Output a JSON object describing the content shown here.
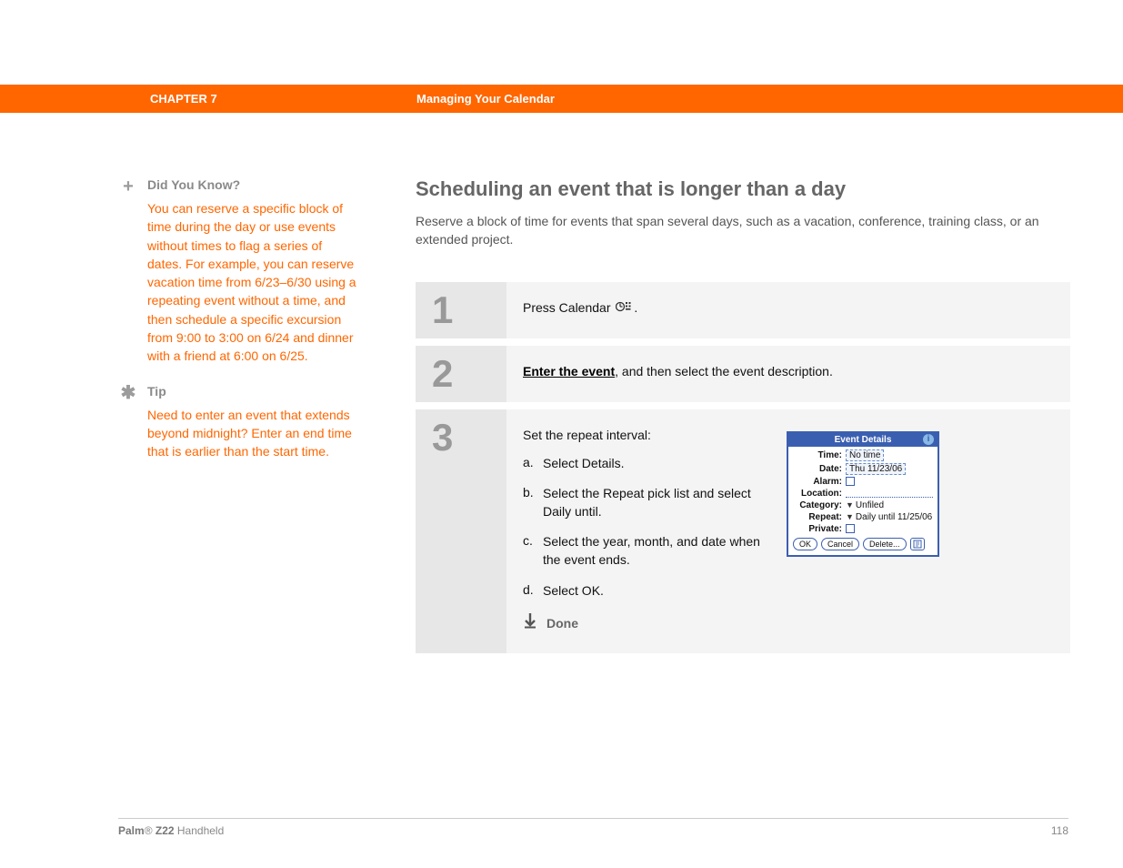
{
  "header": {
    "chapter": "CHAPTER 7",
    "title": "Managing Your Calendar"
  },
  "sidebar": {
    "dyk": {
      "label": "Did You Know?",
      "body": "You can reserve a specific block of time during the day or use events without times to flag a series of dates. For example, you can reserve vacation time from 6/23–6/30 using a repeating event without a time, and then schedule a specific excursion from 9:00 to 3:00 on 6/24 and dinner with a friend at 6:00 on 6/25."
    },
    "tip": {
      "label": "Tip",
      "body": "Need to enter an event that extends beyond midnight? Enter an end time that is earlier than the start time."
    }
  },
  "main": {
    "heading": "Scheduling an event that is longer than a day",
    "intro": "Reserve a block of time for events that span several days, such as a vacation, conference, training class, or an extended project.",
    "steps": {
      "s1": {
        "num": "1",
        "pre": "Press Calendar ",
        "post": "."
      },
      "s2": {
        "num": "2",
        "link": "Enter the event",
        "rest": ", and then select the event description."
      },
      "s3": {
        "num": "3",
        "title": "Set the repeat interval:",
        "a_letter": "a.",
        "a_txt": "Select Details.",
        "b_letter": "b.",
        "b_txt": "Select the Repeat pick list and select Daily until.",
        "c_letter": "c.",
        "c_txt": "Select the year, month, and date when the event ends.",
        "d_letter": "d.",
        "d_txt": "Select OK.",
        "done": "Done"
      }
    }
  },
  "mini": {
    "title": "Event Details",
    "time_label": "Time:",
    "time_value": "No time",
    "date_label": "Date:",
    "date_value": "Thu 11/23/06",
    "alarm_label": "Alarm:",
    "location_label": "Location:",
    "category_label": "Category:",
    "category_value": "Unfiled",
    "repeat_label": "Repeat:",
    "repeat_value": "Daily until 11/25/06",
    "private_label": "Private:",
    "ok": "OK",
    "cancel": "Cancel",
    "delete": "Delete..."
  },
  "footer": {
    "product_bold": "Palm",
    "product_reg": "®",
    "product_model": " Z22",
    "product_rest": " Handheld",
    "page": "118"
  }
}
